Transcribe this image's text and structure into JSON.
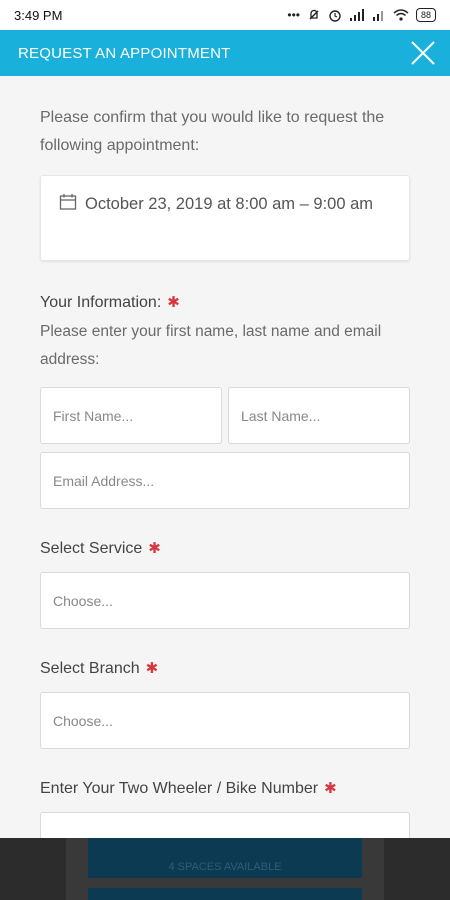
{
  "status_bar": {
    "time": "3:49 PM",
    "battery": "88"
  },
  "modal": {
    "title": "REQUEST AN APPOINTMENT",
    "confirm_text": "Please confirm that you would like to request the following appointment:",
    "appointment": "October 23, 2019 at 8:00 am – 9:00 am",
    "your_info_label": "Your Information:",
    "your_info_help": "Please enter your first name, last name and email address:",
    "first_name_placeholder": "First Name...",
    "last_name_placeholder": "Last Name...",
    "email_placeholder": "Email Address...",
    "service_label": "Select Service",
    "service_value": "Choose...",
    "branch_label": "Select Branch",
    "branch_value": "Choose...",
    "bike_label": "Enter Your Two Wheeler / Bike Number",
    "required_mark": "✱"
  },
  "background": {
    "spaces_text": "4 SPACES AVAILABLE"
  },
  "colors": {
    "header": "#19b0db",
    "required": "#d9363e"
  }
}
